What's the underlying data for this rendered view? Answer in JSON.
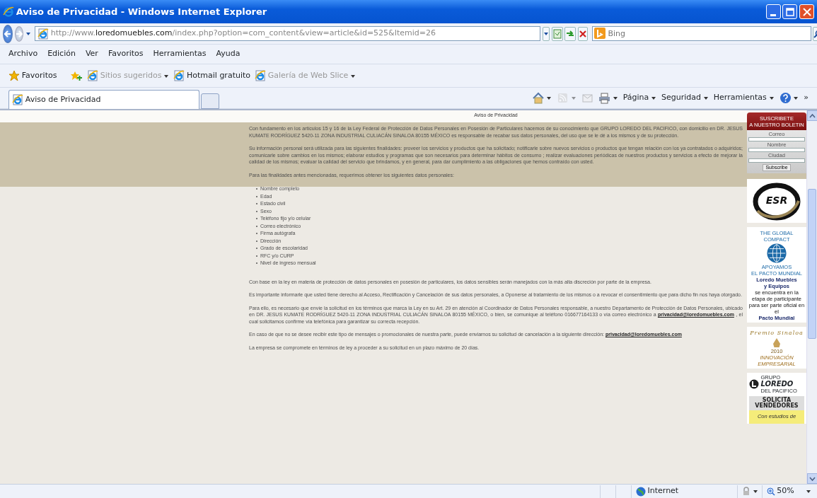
{
  "window": {
    "title": "Aviso de Privacidad - Windows Internet Explorer"
  },
  "address_bar": {
    "url_prefix": "http://www.",
    "url_domain": "loredomuebles.com",
    "url_path": "/index.php?option=com_content&view=article&id=525&Itemid=26",
    "search_placeholder": "Bing"
  },
  "menu": [
    "Archivo",
    "Edición",
    "Ver",
    "Favoritos",
    "Herramientas",
    "Ayuda"
  ],
  "favorites_bar": {
    "label": "Favoritos",
    "items": [
      {
        "label": "Sitios sugeridos",
        "dropdown": true,
        "disabled": true
      },
      {
        "label": "Hotmail gratuito",
        "dropdown": false,
        "disabled": false
      },
      {
        "label": "Galería de Web Slice",
        "dropdown": true,
        "disabled": true
      }
    ]
  },
  "tabs": [
    {
      "label": "Aviso de Privacidad",
      "selected": true
    }
  ],
  "command_bar": [
    {
      "kind": "home",
      "dropdown": true,
      "disabled": false
    },
    {
      "kind": "feed",
      "dropdown": true,
      "disabled": true
    },
    {
      "kind": "mail",
      "dropdown": false,
      "disabled": true
    },
    {
      "kind": "print",
      "dropdown": true,
      "disabled": false
    },
    {
      "kind": "text",
      "label": "Página",
      "dropdown": true
    },
    {
      "kind": "text",
      "label": "Seguridad",
      "dropdown": true
    },
    {
      "kind": "text",
      "label": "Herramientas",
      "dropdown": true
    },
    {
      "kind": "help",
      "dropdown": true
    },
    {
      "kind": "text",
      "label": "»",
      "dropdown": false
    }
  ],
  "page": {
    "title": "Aviso de Privacidad",
    "content": [
      {
        "kind": "paragraph",
        "text": "Con fundamento en los artículos 15 y 16 de la Ley Federal de Protección de Datos Personales en Posesión de Particulares hacemos de su conocimiento que GRUPO LOREDO DEL PACIFICO, con domicilio en DR. JESUS KUMATE RODRÍGUEZ 5420-11 ZONA INDUSTRIAL CULIACÁN SINALOA 80155 MÉXICO es responsable de recabar sus datos personales, del uso que se le dé a los mismos y de su protección."
      },
      {
        "kind": "paragraph",
        "text": "Su información personal será utilizada para las siguientes finalidades: proveer los servicios y productos que ha solicitado; notificarle sobre nuevos servicios o productos que tengan relación con los ya contratados o adquiridos; comunicarle sobre cambios en los mismos; elaborar estudios y programas que son necesarios para determinar hábitos de consumo ; realizar evaluaciones periódicas de nuestros productos y servicios a efecto de mejorar la calidad de los mismos; evaluar la calidad del servicio que brindamos, y en general, para dar cumplimiento a las obligaciones que hemos contraído con usted."
      },
      {
        "kind": "paragraph",
        "text": "Para las finalidades antes mencionadas, requerimos obtener los siguientes datos personales:"
      },
      {
        "kind": "list",
        "items": [
          "Nombre completo",
          "Edad",
          "Estado civil",
          "Sexo",
          "Teléfono fijo y/o celular",
          "Correo electrónico",
          "Firma autógrafa",
          "Dirección",
          "Grado de escolaridad",
          "RFC y/o CURP",
          "Nivel de ingreso mensual"
        ]
      },
      {
        "kind": "paragraph",
        "text": "Con base en la ley en materia de protección de datos personales en posesión de particulares, los datos sensibles serán manejados con la más alta discreción por parte de la empresa."
      },
      {
        "kind": "paragraph",
        "text": "Es importante informarle que usted tiene derecho al Acceso, Rectificación y Cancelación de sus datos personales, a Oponerse al tratamiento de los mismos o a revocar el consentimiento que para dicho fin nos haya otorgado."
      },
      {
        "kind": "paragraph",
        "text": "Para ello, es necesario que envíe la solicitud en los términos que marca la Ley en su Art. 29 en atención al Coordinador de Datos Personales responsable, a nuestro Departamento de Protección de Datos Personales, ubicado en DR. JESUS KUMATE RODRÍGUEZ 5420-11 ZONA INDUSTRIAL CULIACÁN SINALOA 80155 MÉXICO, o bien, se comunique al teléfono 016677164133 o vía correo electrónico a",
        "link": "privacidad@loredomuebles.com",
        "text_after": ", el cual solicitamos confirme vía telefónica para garantizar su correcta recepción."
      },
      {
        "kind": "paragraph",
        "text": "En caso de que no se desee recibir este tipo de mensajes o promocionales de nuestra parte, puede enviarnos su solicitud de cancelación a la siguiente dirección:",
        "link": "privacidad@loredomuebles.com"
      },
      {
        "kind": "paragraph",
        "text": "La empresa se compromete en términos de ley a proceder a su solicitud en un plazo máximo de 20 días."
      }
    ]
  },
  "sidebar": {
    "newsletter": {
      "heading_lines": [
        "SUSCRIBETE",
        "A NUESTRO BOLETIN"
      ],
      "fields": [
        "Correo",
        "Nombre",
        "Ciudad"
      ],
      "button": "Subscribe"
    },
    "banners": [
      {
        "kind": "esr",
        "text": "ESR"
      },
      {
        "kind": "global_compact",
        "arc": "THE GLOBAL COMPACT",
        "lines": [
          "APOYAMOS",
          "EL PACTO MUNDIAL"
        ],
        "company": [
          "Loredo Muebles",
          "y Equipos"
        ],
        "note": [
          "se encuentra en la",
          "etapa de participante",
          "para ser parte oficial en el"
        ],
        "footer": "Pacto Mundial"
      },
      {
        "kind": "premio",
        "arc": "Premio Sinaloa",
        "year": "2010",
        "lines": [
          "INNOVACIÓN",
          "EMPRESARIAL"
        ]
      },
      {
        "kind": "vendedores",
        "group": "GRUPO",
        "brand": "LOREDO",
        "sub": "DEL PACIFICO",
        "headline": [
          "SOLICITA",
          "VENDEDORES"
        ],
        "note": "Con estudios de"
      }
    ]
  },
  "status_bar": {
    "zone": "Internet",
    "zoom": "50%"
  }
}
